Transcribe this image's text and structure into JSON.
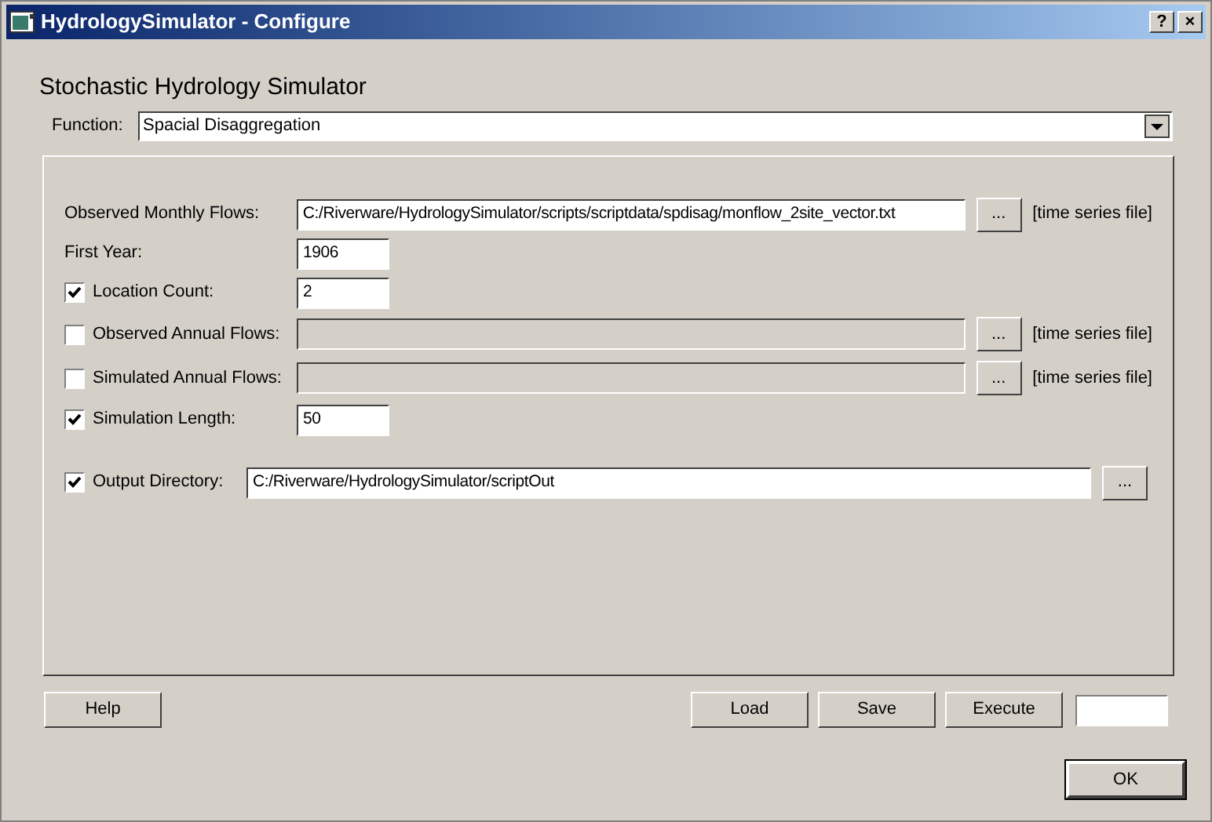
{
  "window": {
    "title": "HydrologySimulator - Configure",
    "buttons": [
      "?",
      "×"
    ]
  },
  "heading": "Stochastic Hydrology Simulator",
  "function": {
    "label": "Function:",
    "value": "Spacial Disaggregation"
  },
  "rows": [
    {
      "kind": "file",
      "label": "Observed Monthly Flows:",
      "value": "C:/Riverware/HydrologySimulator/scripts/scriptdata/spdisag/monflow_2site_vector.txt",
      "browse": "...",
      "hint": "[time series file]"
    },
    {
      "kind": "number",
      "label": "First Year:",
      "value": "1906"
    },
    {
      "kind": "number",
      "label": "Location Count:",
      "checked": true,
      "value": "2"
    },
    {
      "kind": "file",
      "label": "Observed Annual Flows:",
      "checked": false,
      "browse": "...",
      "hint": "[time series file]"
    },
    {
      "kind": "file",
      "label": "Simulated Annual Flows:",
      "checked": false,
      "browse": "...",
      "hint": "[time series file]"
    },
    {
      "kind": "number",
      "label": "Simulation Length:",
      "checked": true,
      "value": "50"
    },
    {
      "kind": "dir",
      "label": "Output Directory:",
      "checked": true,
      "value": "C:/Riverware/HydrologySimulator/scriptOut",
      "browse": "..."
    }
  ],
  "actions": {
    "help": "Help",
    "buttons": [
      "Load",
      "Save",
      "Execute"
    ]
  },
  "ok": "OK"
}
